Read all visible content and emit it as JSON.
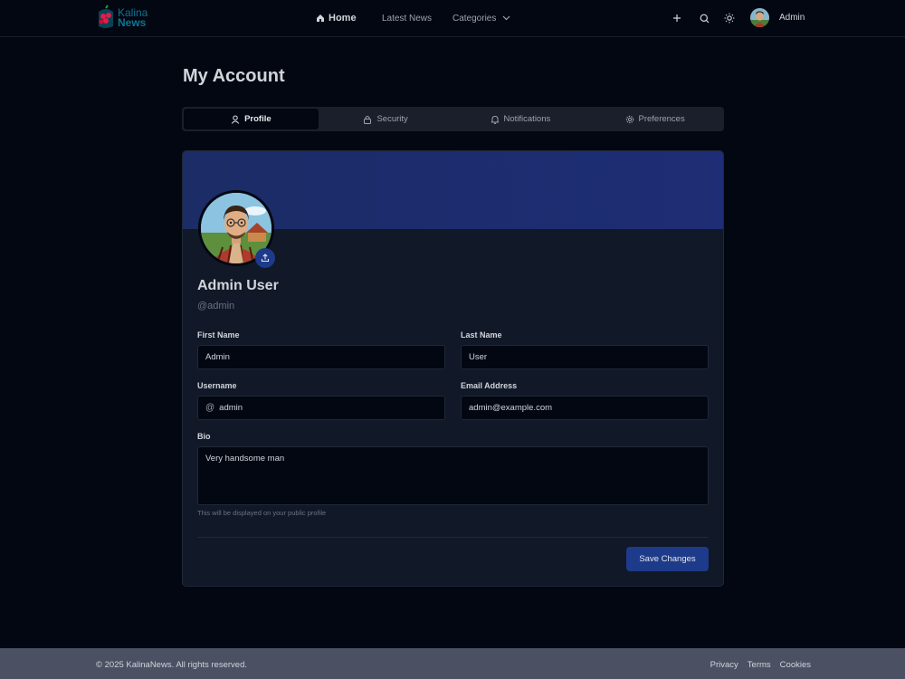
{
  "brand": {
    "name_line1": "Kalina",
    "name_line2": "News",
    "accent": "#0e7490"
  },
  "nav": {
    "home": "Home",
    "latest": "Latest News",
    "categories": "Categories"
  },
  "header": {
    "user_name": "Admin"
  },
  "page": {
    "title": "My Account"
  },
  "tabs": [
    {
      "label": "Profile",
      "icon": "user-icon",
      "active": true
    },
    {
      "label": "Security",
      "icon": "lock-icon"
    },
    {
      "label": "Notifications",
      "icon": "bell-icon"
    },
    {
      "label": "Preferences",
      "icon": "gear-icon"
    }
  ],
  "profile": {
    "display_name": "Admin User",
    "handle": "@admin"
  },
  "form": {
    "first_name_label": "First Name",
    "first_name_value": "Admin",
    "last_name_label": "Last Name",
    "last_name_value": "User",
    "username_label": "Username",
    "username_prefix": "@",
    "username_value": "admin",
    "email_label": "Email Address",
    "email_value": "admin@example.com",
    "bio_label": "Bio",
    "bio_value": "Very handsome man",
    "bio_hint": "This will be displayed on your public profile",
    "save_label": "Save Changes"
  },
  "footer": {
    "copyright": "© 2025 KalinaNews. All rights reserved.",
    "links": [
      "Privacy",
      "Terms",
      "Cookies"
    ]
  },
  "colors": {
    "primary": "#1e3a8a",
    "background": "#030712",
    "card": "#111827"
  }
}
